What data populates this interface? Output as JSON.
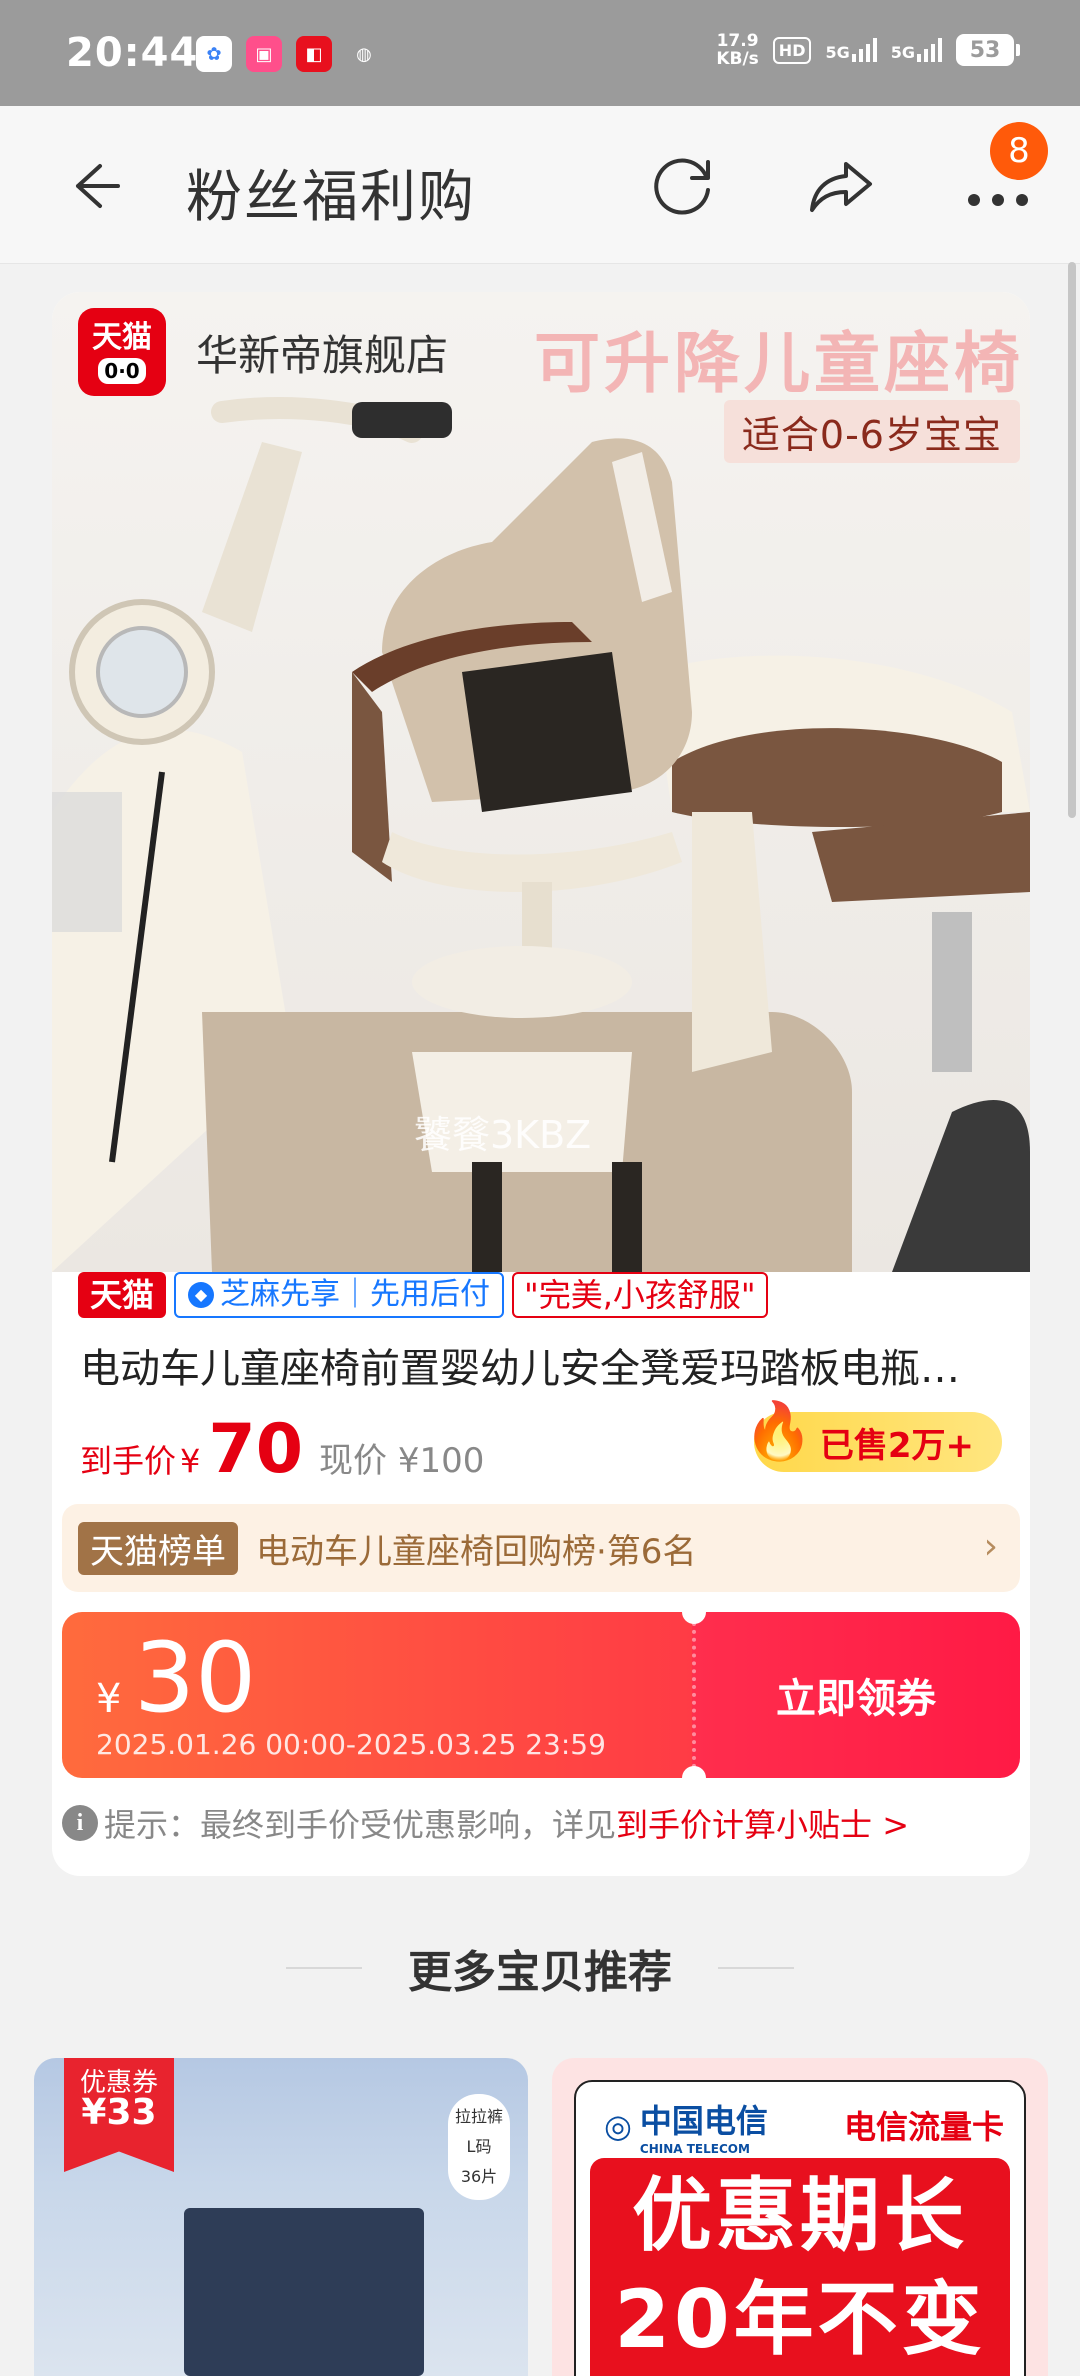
{
  "status_bar": {
    "time": "20:44",
    "net_speed_value": "17.9",
    "net_speed_unit": "KB/s",
    "hd_badge": "HD",
    "signal1": "5G",
    "signal2": "5G",
    "battery": "53"
  },
  "header": {
    "title": "粉丝福利购",
    "badge_count": "8"
  },
  "product": {
    "store_name": "华新帝旗舰店",
    "store_logo_text": "天猫",
    "image_promo_title": "可升降儿童座椅",
    "image_promo_sub": "适合0-6岁宝宝",
    "watermark": "饕餮3KBZ",
    "tag_tmall": "天猫",
    "tag_zhima": "芝麻先享｜先用后付",
    "tag_quote": "\"完美,小孩舒服\"",
    "title": "电动车儿童座椅前置婴幼儿安全凳爱玛踏板电瓶…",
    "price_label": "到手价",
    "price_currency": "¥",
    "price_value": "70",
    "price_now": "现价 ¥100",
    "sold": "已售2万+",
    "rank_tag": "天猫榜单",
    "rank_text": "电动车儿童座椅回购榜·第6名"
  },
  "coupon": {
    "currency": "¥",
    "amount": "30",
    "validity": "2025.01.26 00:00-2025.03.25 23:59",
    "action": "立即领券"
  },
  "tip": {
    "prefix": "提示：最终到手价受优惠影响，详见",
    "link": "到手价计算小贴士 >"
  },
  "more": {
    "title": "更多宝贝推荐",
    "rec1": {
      "ribbon_top": "优惠券",
      "ribbon_amount": "¥33",
      "label_lines": [
        "拉拉裤",
        "L码",
        "36片"
      ]
    },
    "rec2": {
      "brand": "中国电信",
      "brand_en": "CHINA TELECOM",
      "card_label": "电信流量卡",
      "headline1": "优惠期长",
      "headline2": "20年不变"
    }
  },
  "colors": {
    "accent_red": "#e50012",
    "coupon_orange": "#ff6b3d",
    "status_bar": "#9b9b9b"
  },
  "icons": [
    "back-arrow-icon",
    "refresh-icon",
    "share-icon",
    "more-dots-icon",
    "fire-icon",
    "info-icon",
    "chevron-right-icon"
  ]
}
